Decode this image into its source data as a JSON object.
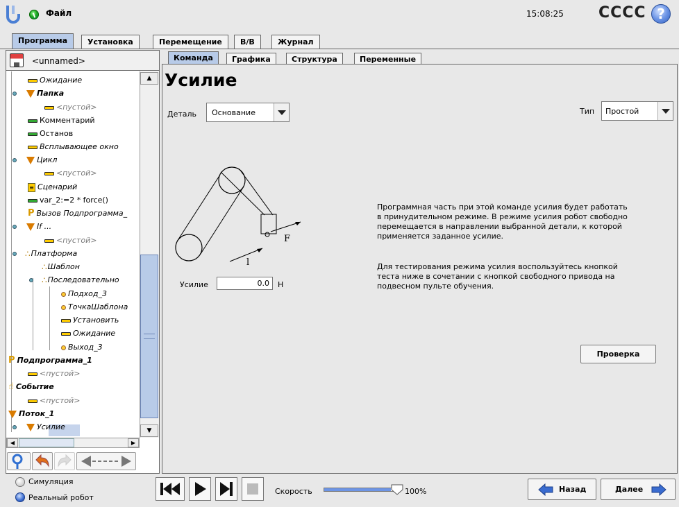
{
  "header": {
    "file_menu": "Файл",
    "clock": "15:08:25",
    "robot_name": "CCCC",
    "help": "?"
  },
  "main_tabs": [
    {
      "label": "Программа",
      "active": true
    },
    {
      "label": "Установка",
      "active": false
    },
    {
      "label": "Перемещение",
      "active": false
    },
    {
      "label": "В/В",
      "active": false
    },
    {
      "label": "Журнал",
      "active": false
    }
  ],
  "program": {
    "name": "<unnamed>"
  },
  "tree": [
    {
      "label": "Ожидание",
      "icon": "dash-yellow-icon"
    },
    {
      "label": "Папка",
      "icon": "folder-triangle-icon"
    },
    {
      "label": "<пустой>",
      "icon": "dash-yellow-icon"
    },
    {
      "label": "Комментарий",
      "icon": "dash-green-icon"
    },
    {
      "label": "Останов",
      "icon": "dash-green-icon"
    },
    {
      "label": "Всплывающее окно",
      "icon": "dash-yellow-icon"
    },
    {
      "label": "Цикл",
      "icon": "loop-triangle-icon"
    },
    {
      "label": "<пустой>",
      "icon": "dash-yellow-icon"
    },
    {
      "label": "Сценарий",
      "icon": "script-icon"
    },
    {
      "label": "var_2:=2 * force()",
      "icon": "dash-green-icon"
    },
    {
      "label": "Вызов Подпрограмма_",
      "icon": "subprogram-call-icon"
    },
    {
      "label": "If ...",
      "icon": "if-triangle-icon"
    },
    {
      "label": "<пустой>",
      "icon": "dash-yellow-icon"
    },
    {
      "label": "Платформа",
      "icon": "pallet-icon"
    },
    {
      "label": "Шаблон",
      "icon": "pattern-icon"
    },
    {
      "label": "Последовательно",
      "icon": "sequence-icon"
    },
    {
      "label": "Подход_3",
      "icon": "waypoint-icon"
    },
    {
      "label": "ТочкаШаблона",
      "icon": "waypoint-icon"
    },
    {
      "label": "Установить",
      "icon": "dash-yellow-icon"
    },
    {
      "label": "Ожидание",
      "icon": "dash-yellow-icon"
    },
    {
      "label": "Выход_3",
      "icon": "waypoint-icon"
    },
    {
      "label": "Подпрограмма_1",
      "icon": "subprogram-icon"
    },
    {
      "label": "<пустой>",
      "icon": "dash-yellow-icon"
    },
    {
      "label": "Событие",
      "icon": "event-icon"
    },
    {
      "label": "<пустой>",
      "icon": "dash-yellow-icon"
    },
    {
      "label": "Поток_1",
      "icon": "thread-triangle-icon"
    },
    {
      "label": "Усилие",
      "icon": "force-triangle-icon"
    }
  ],
  "sub_tabs": [
    {
      "label": "Команда",
      "active": true
    },
    {
      "label": "Графика",
      "active": false
    },
    {
      "label": "Структура",
      "active": false
    },
    {
      "label": "Переменные",
      "active": false
    }
  ],
  "command": {
    "title": "Усилие",
    "detail_label": "Деталь",
    "detail_value": "Основание",
    "type_label": "Тип",
    "type_value": "Простой",
    "force_label": "Усилие",
    "force_value": "0.0",
    "force_unit": "Н",
    "diagram_force_letter": "F",
    "diagram_length_letter": "l",
    "description_1": "Программная часть при этой команде усилия будет работать в принудительном режиме. В режиме усилия робот свободно перемещается в направлении выбранной детали, к которой применяется заданное усилие.",
    "description_2": "Для тестирования режима усилия воспользуйтесь кнопкой теста ниже в сочетании с кнопкой свободного привода на подвесном пульте обучения.",
    "test_button": "Проверка"
  },
  "footer": {
    "simulation": "Симуляция",
    "real_robot": "Реальный робот",
    "speed_label": "Скорость",
    "speed_value": "100%",
    "speed_fraction": 1.0,
    "back": "Назад",
    "next": "Далее"
  },
  "colors": {
    "tab_active": "#b8cbe8",
    "accent_blue": "#3a6cd0",
    "status_green": "#2a2",
    "icon_orange": "#d97b00"
  }
}
